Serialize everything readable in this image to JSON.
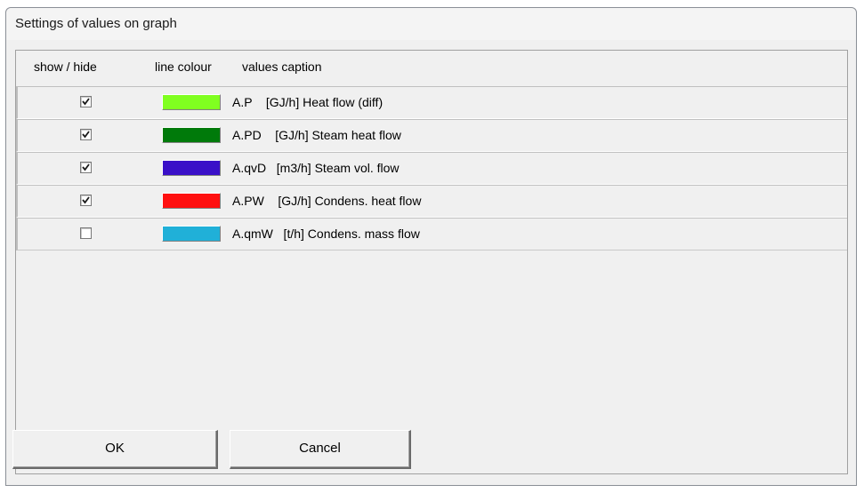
{
  "window": {
    "title": "Settings of values on graph"
  },
  "table": {
    "headers": {
      "show_hide": "show / hide",
      "line_colour": "line colour",
      "values_caption": "values caption"
    },
    "rows": [
      {
        "checked": true,
        "colour": "#80ff20",
        "caption": "A.P    [GJ/h] Heat flow (diff)"
      },
      {
        "checked": true,
        "colour": "#007a0a",
        "caption": "A.PD    [GJ/h] Steam heat flow"
      },
      {
        "checked": true,
        "colour": "#3a10c8",
        "caption": "A.qvD   [m3/h] Steam vol. flow"
      },
      {
        "checked": true,
        "colour": "#ff1010",
        "caption": "A.PW    [GJ/h] Condens. heat flow"
      },
      {
        "checked": false,
        "colour": "#20b0d8",
        "caption": "A.qmW   [t/h] Condens. mass flow"
      }
    ]
  },
  "buttons": {
    "ok_label": "OK",
    "cancel_label": "Cancel"
  }
}
